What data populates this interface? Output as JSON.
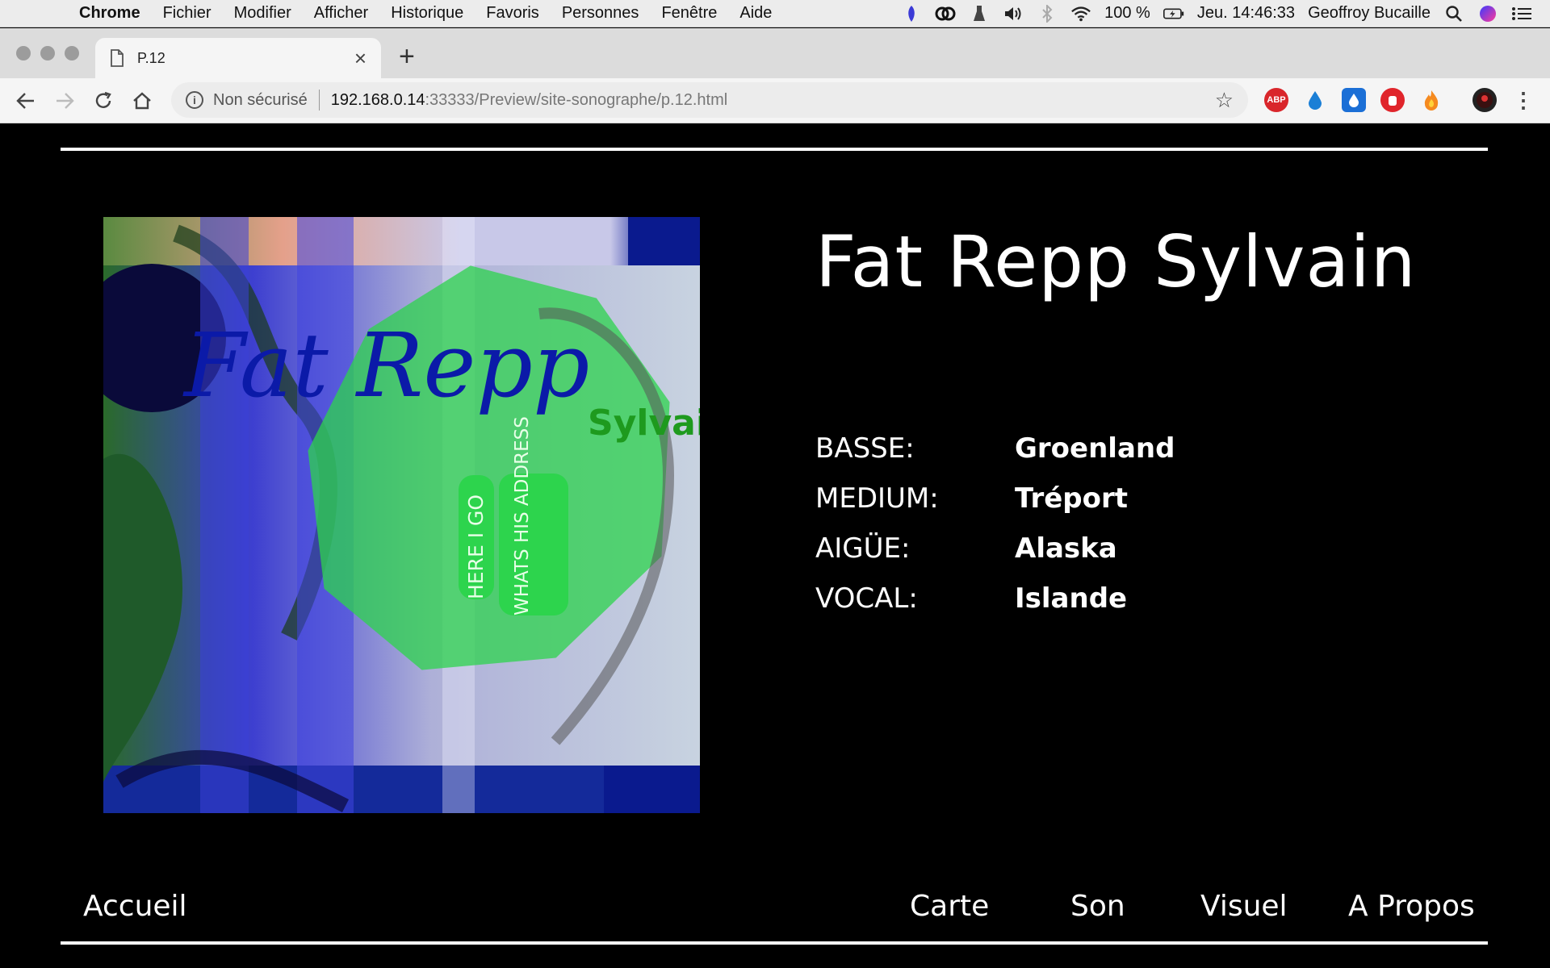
{
  "menubar": {
    "app": "Chrome",
    "items": [
      "Fichier",
      "Modifier",
      "Afficher",
      "Historique",
      "Favoris",
      "Personnes",
      "Fenêtre",
      "Aide"
    ],
    "battery": "100 %",
    "clock": "Jeu. 14:46:33",
    "user": "Geoffroy Bucaille"
  },
  "browser": {
    "tab_title": "P.12",
    "security_label": "Non sécurisé",
    "url_host": "192.168.0.14",
    "url_rest": ":33333/Preview/site-sonographe/p.12.html",
    "extensions": [
      {
        "name": "adblock-plus-icon",
        "label": "ABP",
        "color": "#d9262b"
      },
      {
        "name": "drop-icon",
        "label": "",
        "color": "#1b7fd6"
      },
      {
        "name": "box-drop-icon",
        "label": "",
        "color": "#1b6fd6"
      },
      {
        "name": "stop-hand-icon",
        "label": "",
        "color": "#e0252b"
      },
      {
        "name": "flame-icon",
        "label": "",
        "color": "#f58a1f"
      }
    ]
  },
  "page": {
    "cover_text": {
      "title_line": "Fat Repp",
      "subtitle_line": "Sylvain",
      "tag1": "HERE I GO",
      "tag2": "WHATS HIS ADDRESS"
    },
    "title": "Fat Repp Sylvain",
    "specs": [
      {
        "label": "BASSE:",
        "value": "Groenland"
      },
      {
        "label": "MEDIUM:",
        "value": "Tréport"
      },
      {
        "label": "AIGÜE:",
        "value": "Alaska"
      },
      {
        "label": "VOCAL:",
        "value": "Islande"
      }
    ],
    "nav": {
      "home": "Accueil",
      "map": "Carte",
      "sound": "Son",
      "visual": "Visuel",
      "about": "A Propos"
    }
  }
}
